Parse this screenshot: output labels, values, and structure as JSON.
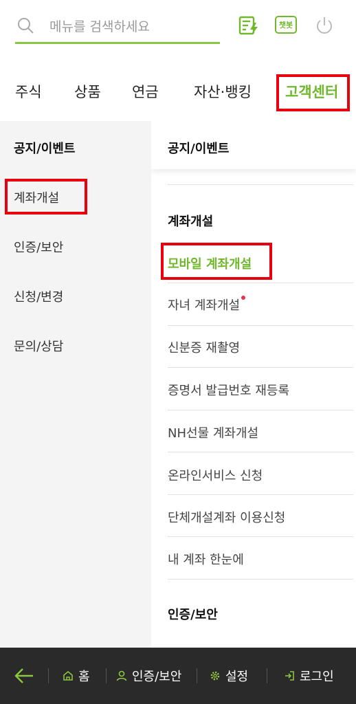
{
  "header": {
    "search_placeholder": "메뉴를 검색하세요",
    "chat_icon_label": "챗봇"
  },
  "top_tabs": [
    "주식",
    "상품",
    "연금",
    "자산·뱅킹",
    "고객센터"
  ],
  "side_nav": {
    "items": [
      "공지/이벤트",
      "계좌개설",
      "인증/보안",
      "신청/변경",
      "문의/상담"
    ]
  },
  "right_panel": {
    "sticky_title": "공지/이벤트",
    "section_account": "계좌개설",
    "account_items": [
      "모바일 계좌개설",
      "자녀 계좌개설",
      "신분증 재촬영",
      "증명서 발급번호 재등록",
      "NH선물 계좌개설",
      "온라인서비스 신청",
      "단체개설계좌 이용신청",
      "내 계좌 한눈에"
    ],
    "section_auth": "인증/보안"
  },
  "bottom_bar": {
    "home": "홈",
    "auth": "인증/보안",
    "settings": "설정",
    "login": "로그인"
  },
  "colors": {
    "accent": "#6fb82c",
    "highlight_box": "#e8000c",
    "bottom_bg": "#2a2a2a",
    "new_dot": "#e8334a"
  }
}
